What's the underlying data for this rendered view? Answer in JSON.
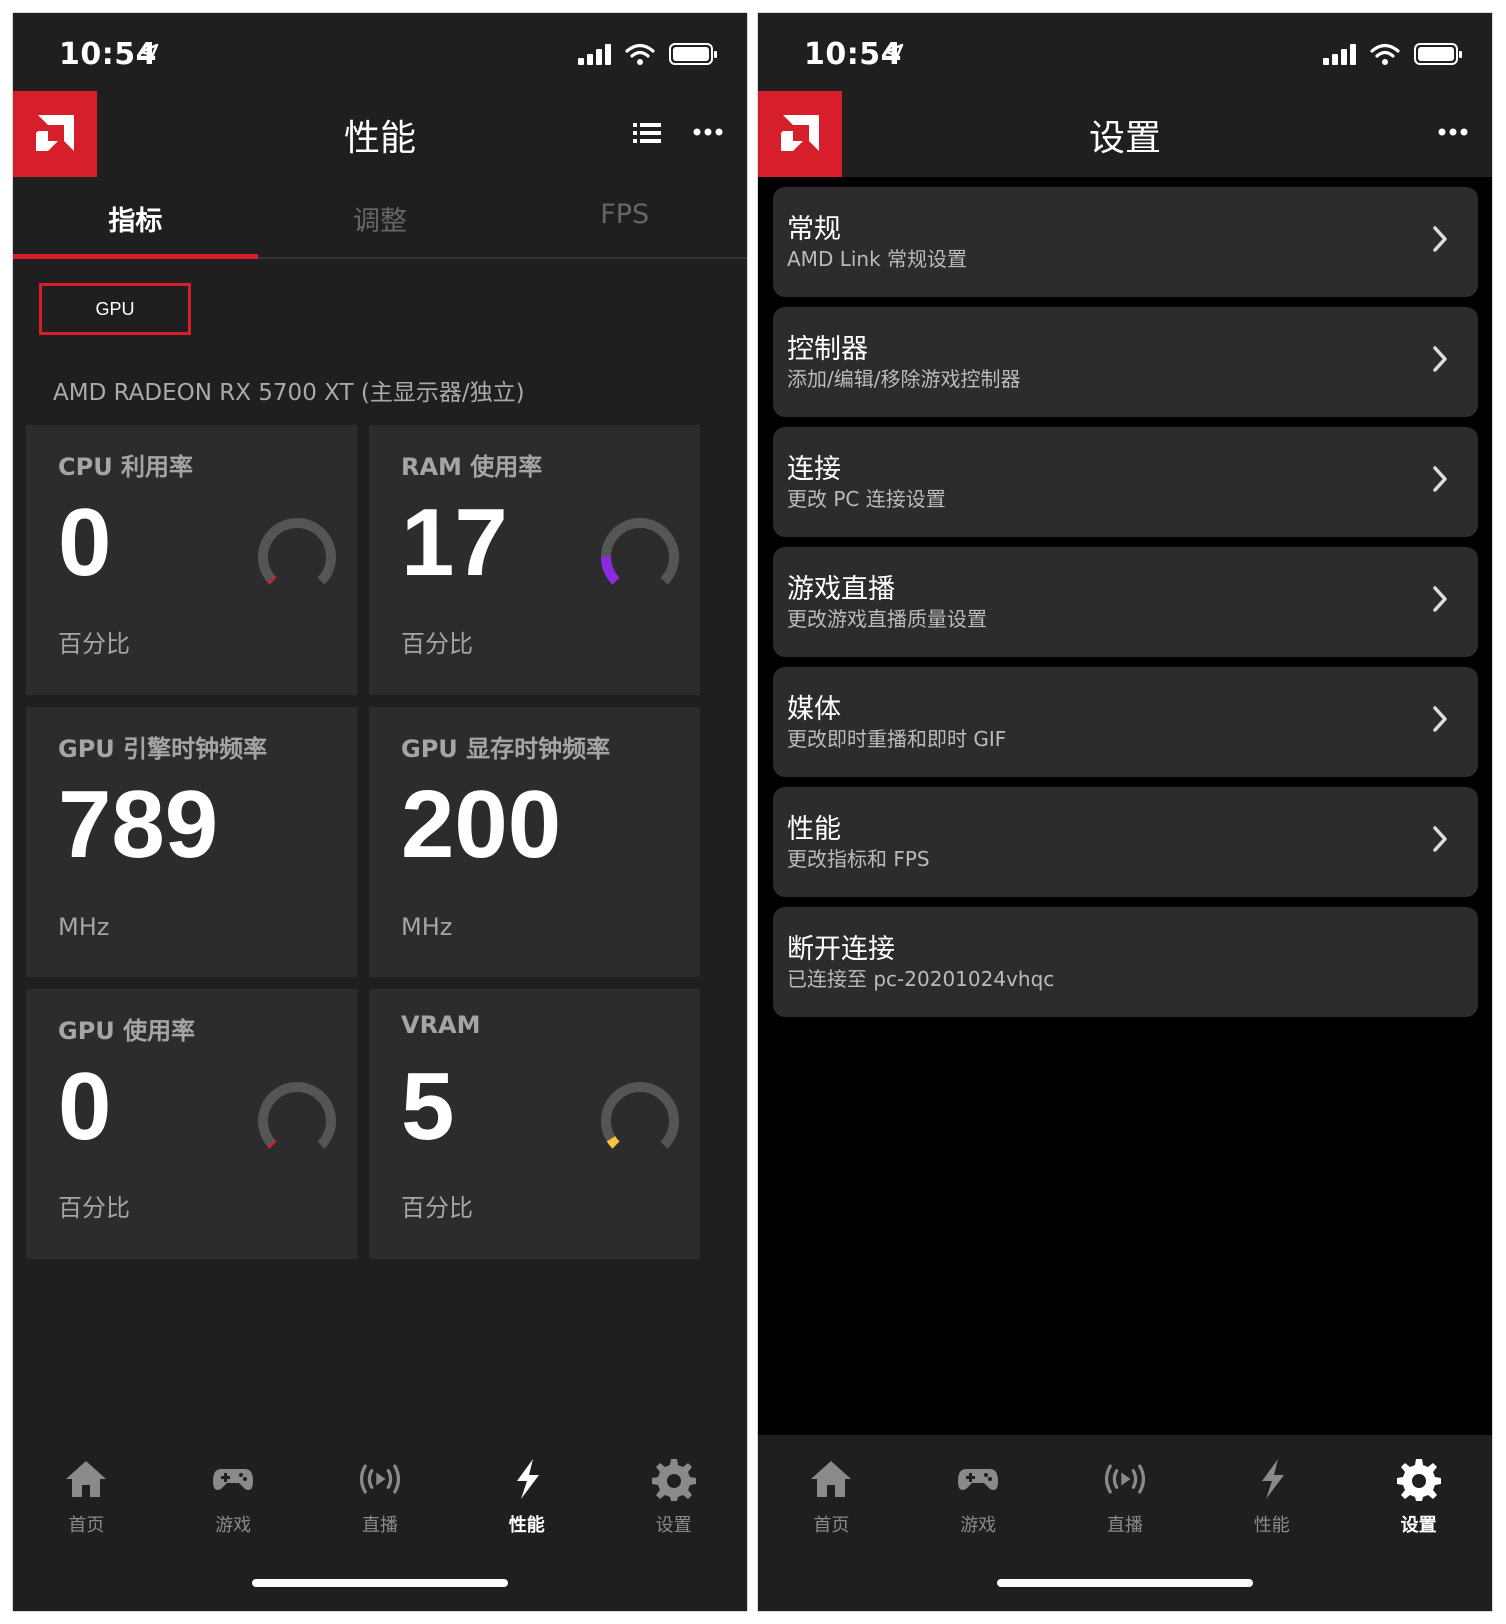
{
  "status": {
    "time": "10:54"
  },
  "left": {
    "header": {
      "title": "性能"
    },
    "tabs": [
      {
        "label": "指标",
        "active": true
      },
      {
        "label": "调整",
        "active": false
      },
      {
        "label": "FPS",
        "active": false
      }
    ],
    "gpu_button": "GPU",
    "device_name": "AMD RADEON RX 5700 XT (主显示器/独立)",
    "cards": [
      {
        "title": "CPU 利用率",
        "value": "0",
        "unit": "百分比",
        "gauge": true,
        "gauge_percent": 0,
        "gauge_color": "#d71f2b"
      },
      {
        "title": "RAM 使用率",
        "value": "17",
        "unit": "百分比",
        "gauge": true,
        "gauge_percent": 17,
        "gauge_color": "#8a2be2"
      },
      {
        "title": "GPU 引擎时钟频率",
        "value": "789",
        "unit": "MHz",
        "gauge": false
      },
      {
        "title": "GPU 显存时钟频率",
        "value": "200",
        "unit": "MHz",
        "gauge": false
      },
      {
        "title": "GPU 使用率",
        "value": "0",
        "unit": "百分比",
        "gauge": true,
        "gauge_percent": 0,
        "gauge_color": "#d71f2b"
      },
      {
        "title": "VRAM",
        "value": "5",
        "unit": "百分比",
        "gauge": true,
        "gauge_percent": 5,
        "gauge_color": "#f5c542"
      }
    ],
    "nav": [
      {
        "label": "首页",
        "icon": "home-icon",
        "active": false
      },
      {
        "label": "游戏",
        "icon": "gamepad-icon",
        "active": false
      },
      {
        "label": "直播",
        "icon": "broadcast-icon",
        "active": false
      },
      {
        "label": "性能",
        "icon": "lightning-icon",
        "active": true
      },
      {
        "label": "设置",
        "icon": "gear-icon",
        "active": false
      }
    ]
  },
  "right": {
    "header": {
      "title": "设置"
    },
    "settings": [
      {
        "title": "常规",
        "subtitle": "AMD Link 常规设置",
        "chevron": true
      },
      {
        "title": "控制器",
        "subtitle": "添加/编辑/移除游戏控制器",
        "chevron": true
      },
      {
        "title": "连接",
        "subtitle": "更改 PC 连接设置",
        "chevron": true
      },
      {
        "title": "游戏直播",
        "subtitle": "更改游戏直播质量设置",
        "chevron": true
      },
      {
        "title": "媒体",
        "subtitle": "更改即时重播和即时 GIF",
        "chevron": true
      },
      {
        "title": "性能",
        "subtitle": "更改指标和 FPS",
        "chevron": true
      },
      {
        "title": "断开连接",
        "subtitle": "已连接至 pc-20201024vhqc",
        "chevron": false
      }
    ],
    "nav": [
      {
        "label": "首页",
        "icon": "home-icon",
        "active": false
      },
      {
        "label": "游戏",
        "icon": "gamepad-icon",
        "active": false
      },
      {
        "label": "直播",
        "icon": "broadcast-icon",
        "active": false
      },
      {
        "label": "性能",
        "icon": "lightning-icon",
        "active": false
      },
      {
        "label": "设置",
        "icon": "gear-icon",
        "active": true
      }
    ]
  },
  "colors": {
    "accent": "#d71f2b",
    "card_bg": "#2c2c2c",
    "bg": "#1f1f1f"
  }
}
